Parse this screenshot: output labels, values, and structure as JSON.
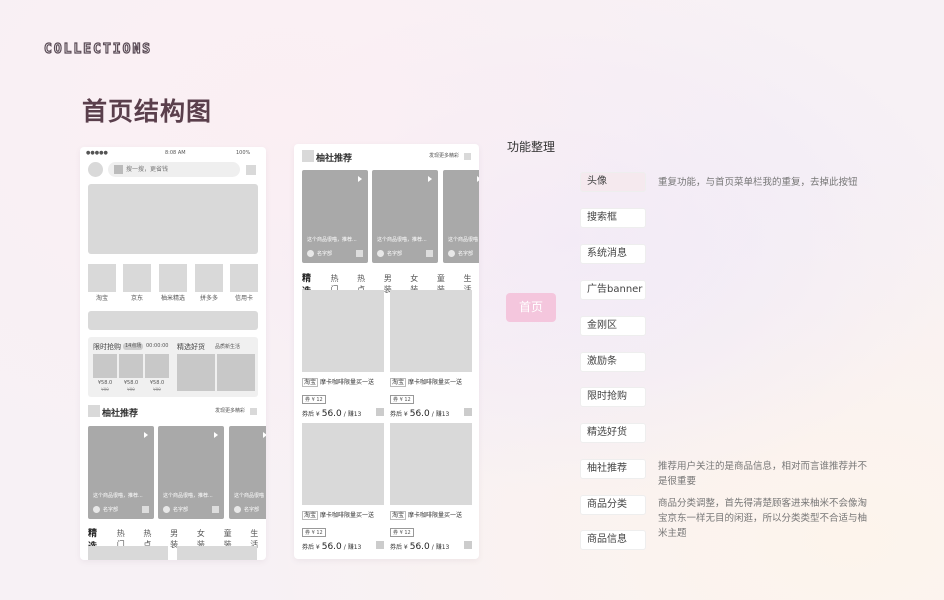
{
  "brand": "COLLECTIONS",
  "page_title": "首页结构图",
  "phone1": {
    "status": {
      "signal": "●●●●●",
      "time": "8:08 AM",
      "battery": "100%"
    },
    "search_placeholder": "搜一搜，更省钱",
    "kingkong": [
      {
        "label": "淘宝"
      },
      {
        "label": "京东"
      },
      {
        "label": "柚米精选"
      },
      {
        "label": "拼多多"
      },
      {
        "label": "信用卡"
      }
    ],
    "flash": {
      "title": "限时抢购",
      "badge": "14点场",
      "time": "00:00:00",
      "items": [
        {
          "price": "¥58.0",
          "old": "¥99"
        },
        {
          "price": "¥58.0",
          "old": "¥99"
        },
        {
          "price": "¥58.0",
          "old": "¥99"
        }
      ]
    },
    "select": {
      "title": "精选好货",
      "sub": "品质新生活"
    },
    "rec": {
      "title": "柚社推荐",
      "more": "发现更多精彩"
    },
    "cards": [
      {
        "desc": "这个商品很喵，推荐...",
        "name": "名字部"
      },
      {
        "desc": "这个商品很喵，推荐...",
        "name": "名字部"
      },
      {
        "desc": "这个商品很喵",
        "name": "名字部"
      }
    ],
    "tabs": [
      "精选",
      "热门",
      "热点",
      "男装",
      "女装",
      "童装",
      "生活"
    ]
  },
  "phone2": {
    "rec": {
      "title": "柚社推荐",
      "more": "发现更多精彩"
    },
    "cards": [
      {
        "desc": "这个商品很喵，推荐...",
        "name": "名字部"
      },
      {
        "desc": "这个商品很喵，推荐...",
        "name": "名字部"
      },
      {
        "desc": "这个商品很喵",
        "name": "名字部"
      }
    ],
    "tabs": [
      "精选",
      "热门",
      "热点",
      "男装",
      "女装",
      "童装",
      "生活"
    ],
    "products": [
      {
        "shop": "淘宝",
        "name": "摩卡咖啡限量买一送",
        "coupon": "券 ¥ 12",
        "pre": "券后 ¥",
        "price": "56.0",
        "earn": "/ 赚13"
      },
      {
        "shop": "淘宝",
        "name": "摩卡咖啡限量买一送",
        "coupon": "券 ¥ 12",
        "pre": "券后 ¥",
        "price": "56.0",
        "earn": "/ 赚13"
      },
      {
        "shop": "淘宝",
        "name": "摩卡咖啡限量买一送",
        "coupon": "券 ¥ 12",
        "pre": "券后 ¥",
        "price": "56.0",
        "earn": "/ 赚13"
      },
      {
        "shop": "淘宝",
        "name": "摩卡咖啡限量买一送",
        "coupon": "券 ¥ 12",
        "pre": "券后 ¥",
        "price": "56.0",
        "earn": "/ 赚13"
      }
    ]
  },
  "features": {
    "title": "功能整理",
    "home_label": "首页",
    "items": [
      "头像",
      "搜索框",
      "系统消息",
      "广告banner",
      "金刚区",
      "激励条",
      "限时抢购",
      "精选好货",
      "柚社推荐",
      "商品分类",
      "商品信息"
    ],
    "notes": {
      "avatar": "重复功能，与首页菜单栏我的重复，去掉此按钮",
      "rec": "推荐用户关注的是商品信息，相对而言谁推荐并不是很重要",
      "cat": "商品分类调整，首先得清楚顾客进来柚米不会像淘宝京东一样无目的闲逛，所以分类类型不合适与柚米主题"
    }
  },
  "colors": {
    "accent": "#f4c6dd",
    "title": "#5a3f4c"
  }
}
